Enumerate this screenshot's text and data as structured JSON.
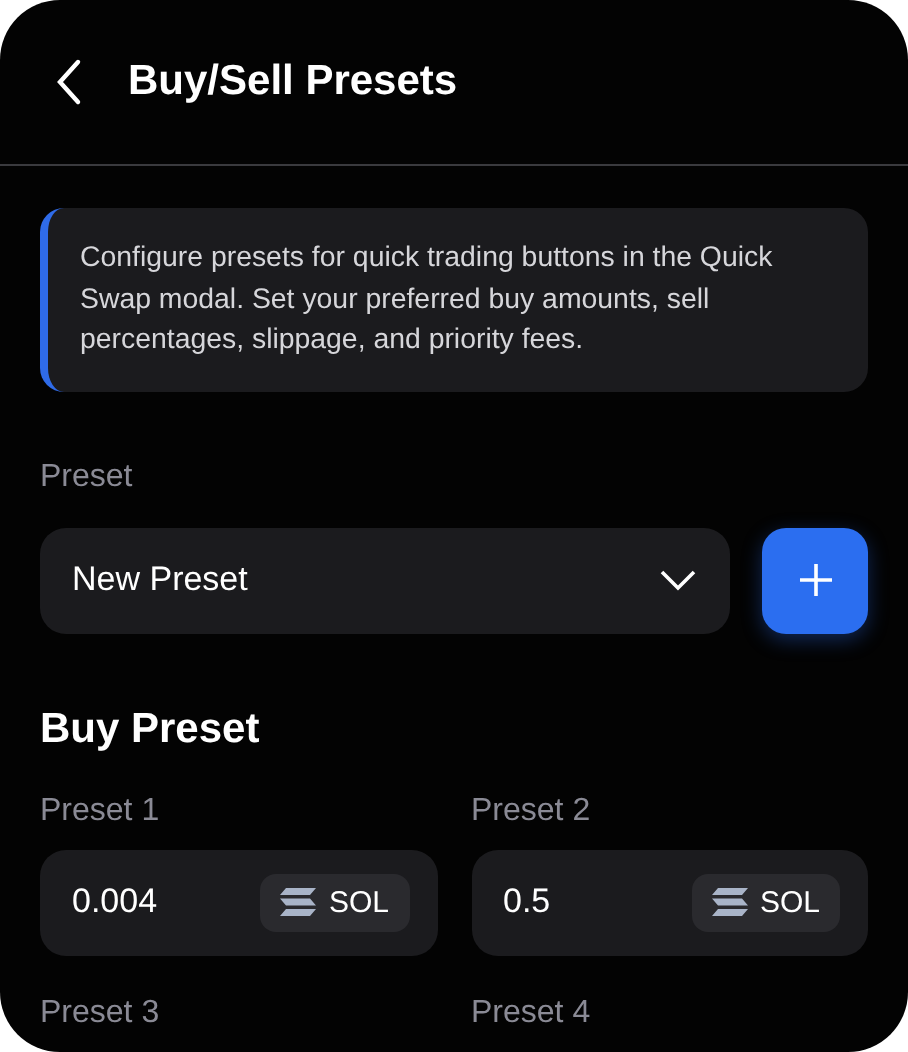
{
  "header": {
    "title": "Buy/Sell Presets"
  },
  "info": {
    "text": "Configure presets for quick trading buttons in the Quick Swap modal. Set your preferred buy amounts, sell percentages, slippage, and priority fees."
  },
  "preset": {
    "label": "Preset",
    "value": "New Preset"
  },
  "buy_preset": {
    "title": "Buy Preset",
    "fields": [
      {
        "label": "Preset 1",
        "value": "0.004",
        "unit": "SOL"
      },
      {
        "label": "Preset 2",
        "value": "0.5",
        "unit": "SOL"
      },
      {
        "label": "Preset 3"
      },
      {
        "label": "Preset 4"
      }
    ]
  }
}
